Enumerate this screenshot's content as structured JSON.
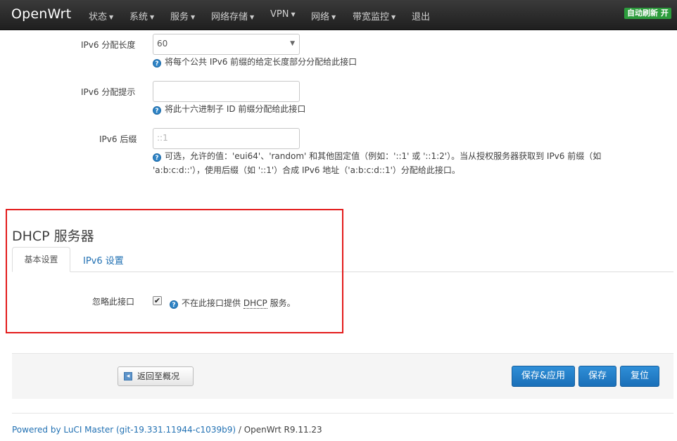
{
  "navbar": {
    "brand": "OpenWrt",
    "menu": [
      "状态",
      "系统",
      "服务",
      "网络存储",
      "VPN",
      "网络",
      "带宽监控",
      "退出"
    ],
    "autorefresh": "自动刷新 开"
  },
  "ipv6_assign": {
    "label": "IPv6 分配长度",
    "value": "60",
    "help": "将每个公共 IPv6 前缀的给定长度部分分配给此接口"
  },
  "ipv6_hint": {
    "label": "IPv6 分配提示",
    "value": "",
    "help": "将此十六进制子 ID 前缀分配给此接口"
  },
  "ipv6_suffix": {
    "label": "IPv6 后缀",
    "placeholder": "::1",
    "help_line1": "可选，允许的值：'eui64'、'random' 和其他固定值（例如：'::1' 或 '::1:2'）。当从授权服务器获取到 IPv6 前缀（如",
    "help_line2": "'a:b:c:d::'），使用后缀（如 '::1'）合成 IPv6 地址（'a:b:c:d::1'）分配给此接口。"
  },
  "dhcp": {
    "title": "DHCP 服务器",
    "tabs": [
      "基本设置",
      "IPv6 设置"
    ],
    "ignore_label": "忽略此接口",
    "ignore_checked": true,
    "ignore_help_prefix": "不在此接口提供",
    "ignore_help_abbr": "DHCP",
    "ignore_help_suffix": "服务。"
  },
  "actions": {
    "back": "返回至概况",
    "save_apply": "保存&应用",
    "save": "保存",
    "reset": "复位"
  },
  "footer": {
    "link": "Powered by LuCI Master (git-19.331.11944-c1039b9)",
    "text": " / OpenWrt R9.11.23"
  },
  "colors": {
    "primary": "#1f7cc7",
    "highlight_box": "#e31b1b",
    "autorefresh": "#2c9c3c"
  }
}
